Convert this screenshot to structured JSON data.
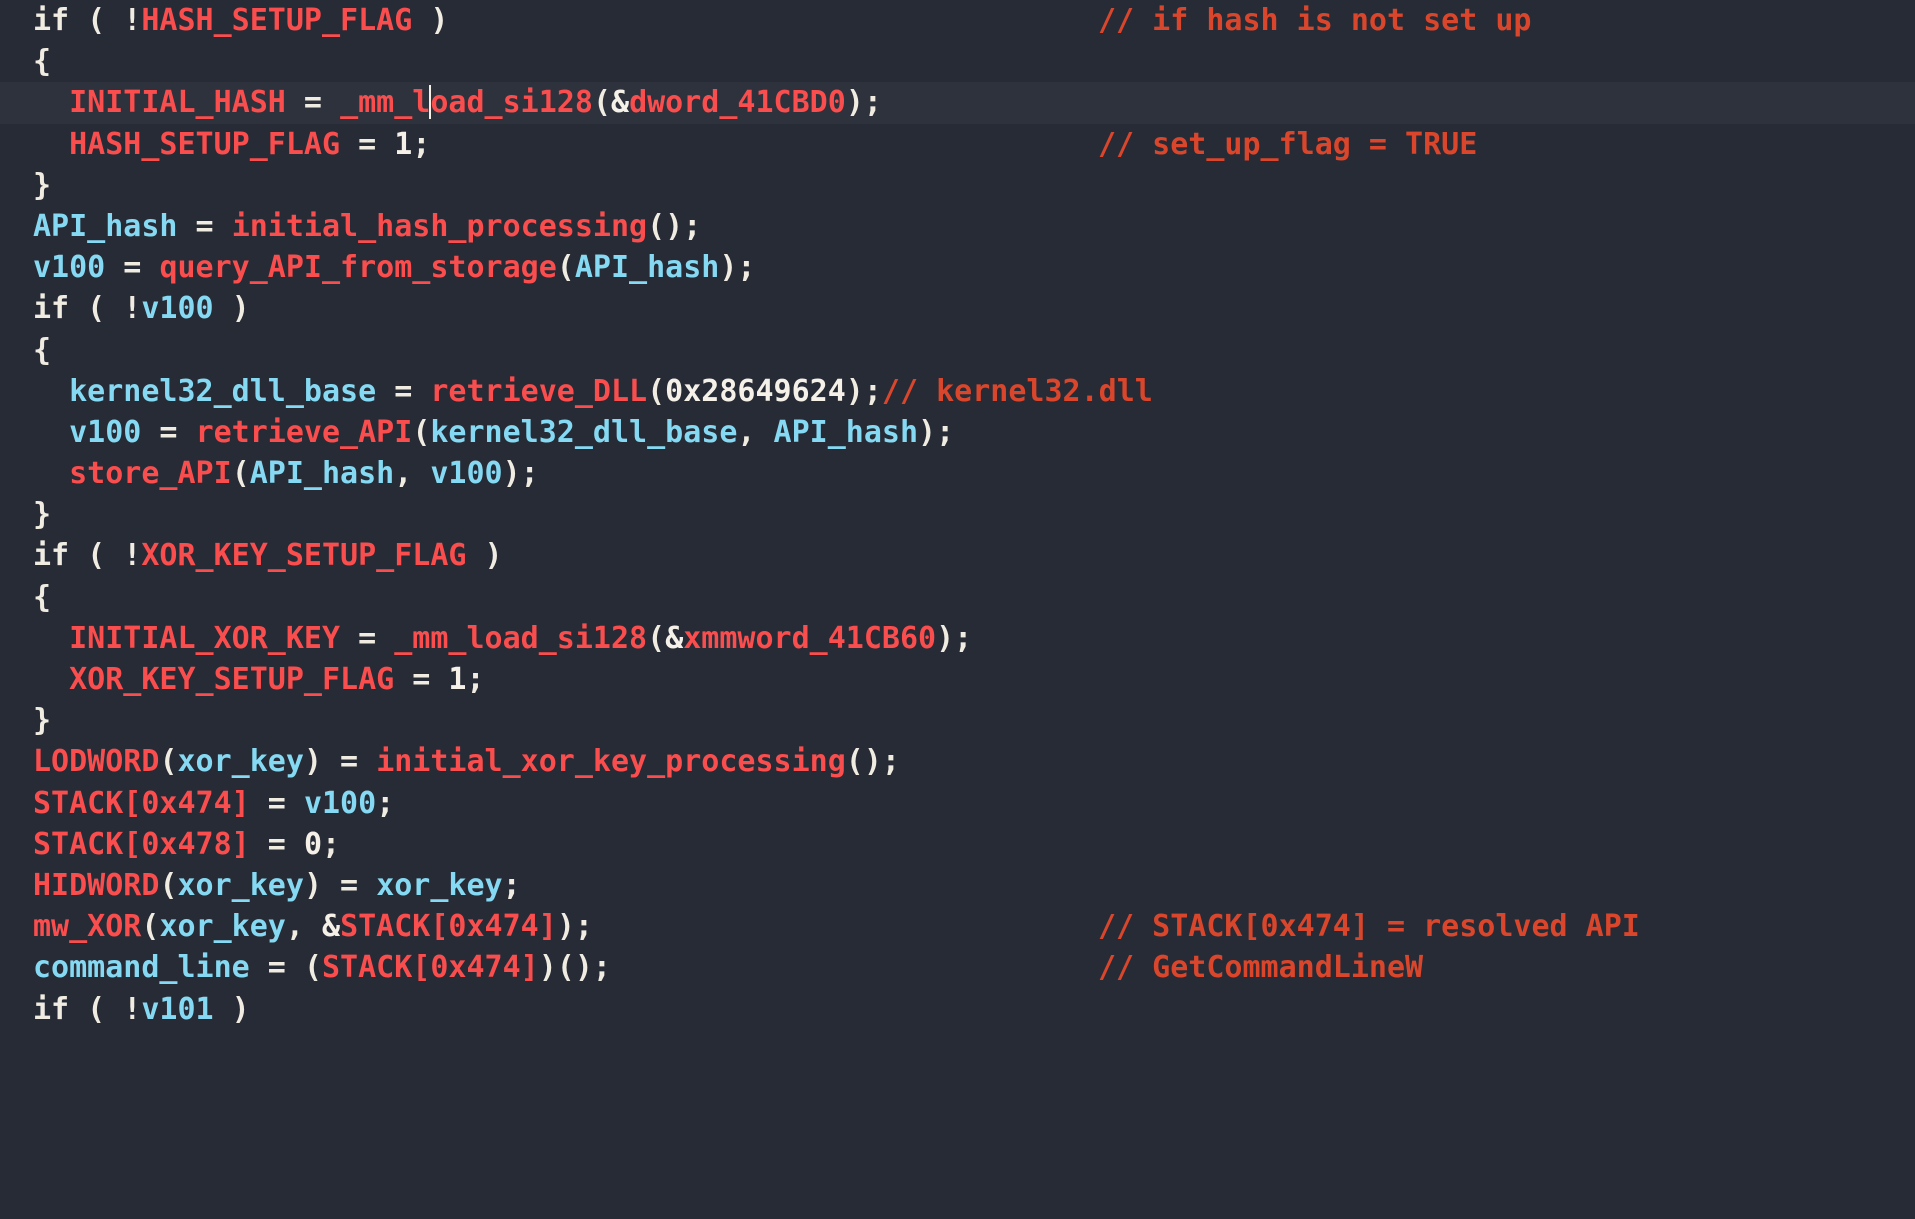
{
  "editor": {
    "kind": "decompiler-pseudocode-view",
    "theme": "dark",
    "background_color": "#272b36",
    "highlight_color": "#2e323d",
    "colors": {
      "keyword": "#f0ece2",
      "variable": "#85d9f2",
      "function": "#fa4d4d",
      "global": "#fa4d4d",
      "number": "#f5f1e8",
      "comment": "#d9462b"
    },
    "caret": {
      "line_index": 2,
      "after_text": "_mm_l"
    }
  },
  "lines": [
    {
      "id": "line-1",
      "indent": 0,
      "highlighted": false,
      "text": "if ( !HASH_SETUP_FLAG )",
      "comment": "// if hash is not set up",
      "tokens": [
        {
          "t": "if ( !",
          "c": "t-key"
        },
        {
          "t": "HASH_SETUP_FLAG",
          "c": "t-glob"
        },
        {
          "t": " )",
          "c": "t-key"
        }
      ]
    },
    {
      "id": "line-2",
      "indent": 0,
      "highlighted": false,
      "text": "{",
      "comment": "",
      "tokens": [
        {
          "t": "{",
          "c": "t-key"
        }
      ]
    },
    {
      "id": "line-3",
      "indent": 1,
      "highlighted": true,
      "text": "  INITIAL_HASH = _mm_load_si128(&dword_41CBD0);",
      "comment": "",
      "tokens": [
        {
          "t": "  ",
          "c": "t-key"
        },
        {
          "t": "INITIAL_HASH",
          "c": "t-glob"
        },
        {
          "t": " = ",
          "c": "t-key"
        },
        {
          "t": "_mm_l",
          "c": "t-fn"
        },
        {
          "t": "CARET",
          "c": "caret"
        },
        {
          "t": "oad_si128",
          "c": "t-fn"
        },
        {
          "t": "(",
          "c": "t-key"
        },
        {
          "t": "&",
          "c": "t-amp"
        },
        {
          "t": "dword_41CBD0",
          "c": "t-glob"
        },
        {
          "t": ");",
          "c": "t-key"
        }
      ]
    },
    {
      "id": "line-4",
      "indent": 1,
      "highlighted": false,
      "text": "  HASH_SETUP_FLAG = 1;",
      "comment": "// set_up_flag = TRUE",
      "tokens": [
        {
          "t": "  ",
          "c": "t-key"
        },
        {
          "t": "HASH_SETUP_FLAG",
          "c": "t-glob"
        },
        {
          "t": " = ",
          "c": "t-key"
        },
        {
          "t": "1",
          "c": "t-num"
        },
        {
          "t": ";",
          "c": "t-key"
        }
      ]
    },
    {
      "id": "line-5",
      "indent": 0,
      "highlighted": false,
      "text": "}",
      "comment": "",
      "tokens": [
        {
          "t": "}",
          "c": "t-key"
        }
      ]
    },
    {
      "id": "line-6",
      "indent": 0,
      "highlighted": false,
      "text": "API_hash = initial_hash_processing();",
      "comment": "",
      "tokens": [
        {
          "t": "API_hash",
          "c": "t-var"
        },
        {
          "t": " = ",
          "c": "t-key"
        },
        {
          "t": "initial_hash_processing",
          "c": "t-fn"
        },
        {
          "t": "();",
          "c": "t-key"
        }
      ]
    },
    {
      "id": "line-7",
      "indent": 0,
      "highlighted": false,
      "text": "v100 = query_API_from_storage(API_hash);",
      "comment": "",
      "tokens": [
        {
          "t": "v100",
          "c": "t-var"
        },
        {
          "t": " = ",
          "c": "t-key"
        },
        {
          "t": "query_API_from_storage",
          "c": "t-fn"
        },
        {
          "t": "(",
          "c": "t-key"
        },
        {
          "t": "API_hash",
          "c": "t-var"
        },
        {
          "t": ");",
          "c": "t-key"
        }
      ]
    },
    {
      "id": "line-8",
      "indent": 0,
      "highlighted": false,
      "text": "if ( !v100 )",
      "comment": "",
      "tokens": [
        {
          "t": "if ( !",
          "c": "t-key"
        },
        {
          "t": "v100",
          "c": "t-var"
        },
        {
          "t": " )",
          "c": "t-key"
        }
      ]
    },
    {
      "id": "line-9",
      "indent": 0,
      "highlighted": false,
      "text": "{",
      "comment": "",
      "tokens": [
        {
          "t": "{",
          "c": "t-key"
        }
      ]
    },
    {
      "id": "line-10",
      "indent": 1,
      "highlighted": false,
      "text": "  kernel32_dll_base = retrieve_DLL(0x28649624);// kernel32.dll",
      "comment": "",
      "tokens": [
        {
          "t": "  ",
          "c": "t-key"
        },
        {
          "t": "kernel32_dll_base",
          "c": "t-var"
        },
        {
          "t": " = ",
          "c": "t-key"
        },
        {
          "t": "retrieve_DLL",
          "c": "t-fn"
        },
        {
          "t": "(",
          "c": "t-key"
        },
        {
          "t": "0x28649624",
          "c": "t-num"
        },
        {
          "t": ");",
          "c": "t-key"
        },
        {
          "t": "// kernel32.dll",
          "c": "t-cmt"
        }
      ]
    },
    {
      "id": "line-11",
      "indent": 1,
      "highlighted": false,
      "text": "  v100 = retrieve_API(kernel32_dll_base, API_hash);",
      "comment": "",
      "tokens": [
        {
          "t": "  ",
          "c": "t-key"
        },
        {
          "t": "v100",
          "c": "t-var"
        },
        {
          "t": " = ",
          "c": "t-key"
        },
        {
          "t": "retrieve_API",
          "c": "t-fn"
        },
        {
          "t": "(",
          "c": "t-key"
        },
        {
          "t": "kernel32_dll_base",
          "c": "t-var"
        },
        {
          "t": ", ",
          "c": "t-key"
        },
        {
          "t": "API_hash",
          "c": "t-var"
        },
        {
          "t": ");",
          "c": "t-key"
        }
      ]
    },
    {
      "id": "line-12",
      "indent": 1,
      "highlighted": false,
      "text": "  store_API(API_hash, v100);",
      "comment": "",
      "tokens": [
        {
          "t": "  ",
          "c": "t-key"
        },
        {
          "t": "store_API",
          "c": "t-fn"
        },
        {
          "t": "(",
          "c": "t-key"
        },
        {
          "t": "API_hash",
          "c": "t-var"
        },
        {
          "t": ", ",
          "c": "t-key"
        },
        {
          "t": "v100",
          "c": "t-var"
        },
        {
          "t": ");",
          "c": "t-key"
        }
      ]
    },
    {
      "id": "line-13",
      "indent": 0,
      "highlighted": false,
      "text": "}",
      "comment": "",
      "tokens": [
        {
          "t": "}",
          "c": "t-key"
        }
      ]
    },
    {
      "id": "line-14",
      "indent": 0,
      "highlighted": false,
      "text": "if ( !XOR_KEY_SETUP_FLAG )",
      "comment": "",
      "tokens": [
        {
          "t": "if ( !",
          "c": "t-key"
        },
        {
          "t": "XOR_KEY_SETUP_FLAG",
          "c": "t-glob"
        },
        {
          "t": " )",
          "c": "t-key"
        }
      ]
    },
    {
      "id": "line-15",
      "indent": 0,
      "highlighted": false,
      "text": "{",
      "comment": "",
      "tokens": [
        {
          "t": "{",
          "c": "t-key"
        }
      ]
    },
    {
      "id": "line-16",
      "indent": 1,
      "highlighted": false,
      "text": "  INITIAL_XOR_KEY = _mm_load_si128(&xmmword_41CB60);",
      "comment": "",
      "tokens": [
        {
          "t": "  ",
          "c": "t-key"
        },
        {
          "t": "INITIAL_XOR_KEY",
          "c": "t-glob"
        },
        {
          "t": " = ",
          "c": "t-key"
        },
        {
          "t": "_mm_load_si128",
          "c": "t-fn"
        },
        {
          "t": "(",
          "c": "t-key"
        },
        {
          "t": "&",
          "c": "t-amp"
        },
        {
          "t": "xmmword_41CB60",
          "c": "t-glob"
        },
        {
          "t": ");",
          "c": "t-key"
        }
      ]
    },
    {
      "id": "line-17",
      "indent": 1,
      "highlighted": false,
      "text": "  XOR_KEY_SETUP_FLAG = 1;",
      "comment": "",
      "tokens": [
        {
          "t": "  ",
          "c": "t-key"
        },
        {
          "t": "XOR_KEY_SETUP_FLAG",
          "c": "t-glob"
        },
        {
          "t": " = ",
          "c": "t-key"
        },
        {
          "t": "1",
          "c": "t-num"
        },
        {
          "t": ";",
          "c": "t-key"
        }
      ]
    },
    {
      "id": "line-18",
      "indent": 0,
      "highlighted": false,
      "text": "}",
      "comment": "",
      "tokens": [
        {
          "t": "}",
          "c": "t-key"
        }
      ]
    },
    {
      "id": "line-19",
      "indent": 0,
      "highlighted": false,
      "text": "LODWORD(xor_key) = initial_xor_key_processing();",
      "comment": "",
      "tokens": [
        {
          "t": "LODWORD",
          "c": "t-fn"
        },
        {
          "t": "(",
          "c": "t-key"
        },
        {
          "t": "xor_key",
          "c": "t-var"
        },
        {
          "t": ")",
          "c": "t-key"
        },
        {
          "t": " = ",
          "c": "t-key"
        },
        {
          "t": "initial_xor_key_processing",
          "c": "t-fn"
        },
        {
          "t": "();",
          "c": "t-key"
        }
      ]
    },
    {
      "id": "line-20",
      "indent": 0,
      "highlighted": false,
      "text": "STACK[0x474] = v100;",
      "comment": "",
      "tokens": [
        {
          "t": "STACK[0x474]",
          "c": "t-glob"
        },
        {
          "t": " = ",
          "c": "t-key"
        },
        {
          "t": "v100",
          "c": "t-var"
        },
        {
          "t": ";",
          "c": "t-key"
        }
      ]
    },
    {
      "id": "line-21",
      "indent": 0,
      "highlighted": false,
      "text": "STACK[0x478] = 0;",
      "comment": "",
      "tokens": [
        {
          "t": "STACK[0x478]",
          "c": "t-glob"
        },
        {
          "t": " = ",
          "c": "t-key"
        },
        {
          "t": "0",
          "c": "t-num"
        },
        {
          "t": ";",
          "c": "t-key"
        }
      ]
    },
    {
      "id": "line-22",
      "indent": 0,
      "highlighted": false,
      "text": "HIDWORD(xor_key) = xor_key;",
      "comment": "",
      "tokens": [
        {
          "t": "HIDWORD",
          "c": "t-fn"
        },
        {
          "t": "(",
          "c": "t-key"
        },
        {
          "t": "xor_key",
          "c": "t-var"
        },
        {
          "t": ")",
          "c": "t-key"
        },
        {
          "t": " = ",
          "c": "t-key"
        },
        {
          "t": "xor_key",
          "c": "t-var"
        },
        {
          "t": ";",
          "c": "t-key"
        }
      ]
    },
    {
      "id": "line-23",
      "indent": 0,
      "highlighted": false,
      "text": "mw_XOR(xor_key, &STACK[0x474]);",
      "comment": "// STACK[0x474] = resolved API",
      "tokens": [
        {
          "t": "mw_XOR",
          "c": "t-fn"
        },
        {
          "t": "(",
          "c": "t-key"
        },
        {
          "t": "xor_key",
          "c": "t-var"
        },
        {
          "t": ", ",
          "c": "t-key"
        },
        {
          "t": "&",
          "c": "t-amp"
        },
        {
          "t": "STACK[0x474]",
          "c": "t-glob"
        },
        {
          "t": ");",
          "c": "t-key"
        }
      ]
    },
    {
      "id": "line-24",
      "indent": 0,
      "highlighted": false,
      "text": "command_line = (STACK[0x474])();",
      "comment": "// GetCommandLineW",
      "tokens": [
        {
          "t": "command_line",
          "c": "t-var"
        },
        {
          "t": " = ",
          "c": "t-key"
        },
        {
          "t": "(",
          "c": "t-key"
        },
        {
          "t": "STACK[0x474]",
          "c": "t-glob"
        },
        {
          "t": ")();",
          "c": "t-key"
        }
      ]
    },
    {
      "id": "line-25",
      "indent": 0,
      "highlighted": false,
      "clipped": true,
      "text": "if ( !v101 )",
      "comment": "",
      "tokens": [
        {
          "t": "if ( !",
          "c": "t-key"
        },
        {
          "t": "v101",
          "c": "t-var"
        },
        {
          "t": " )",
          "c": "t-key"
        }
      ]
    }
  ]
}
